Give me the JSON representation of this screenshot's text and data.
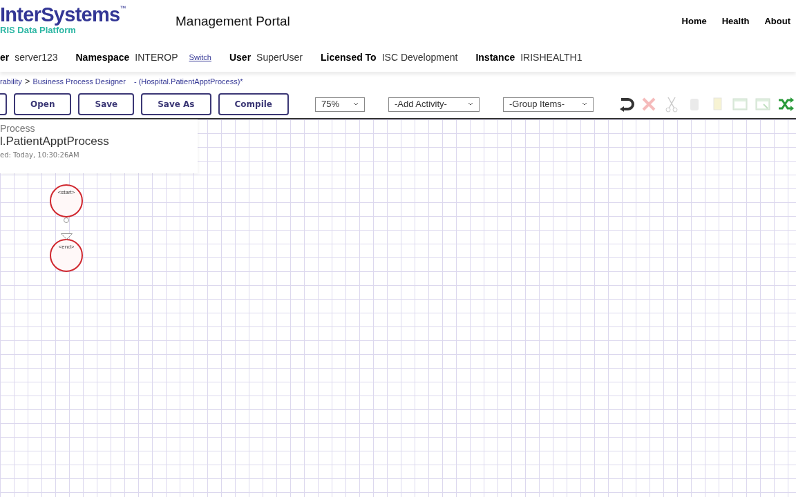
{
  "header": {
    "logo": "InterSystems",
    "logo_tm": "™",
    "logo_subtitle": "RIS Data Platform",
    "title": "Management Portal",
    "nav": [
      "Home",
      "Health",
      "About"
    ]
  },
  "info_bar": [
    {
      "label": "er",
      "value": "server123"
    },
    {
      "label": "Namespace",
      "value": "INTEROP",
      "link": "Switch"
    },
    {
      "label": "User",
      "value": "SuperUser"
    },
    {
      "label": "Licensed To",
      "value": "ISC Development"
    },
    {
      "label": "Instance",
      "value": "IRISHEALTH1"
    }
  ],
  "breadcrumb": {
    "items": [
      "rability",
      "Business Process Designer"
    ],
    "separator": ">",
    "suffix": "- (Hospital.PatientApptProcess)*"
  },
  "toolbar": {
    "buttons": [
      "Open",
      "Save",
      "Save As",
      "Compile"
    ],
    "dropdowns": [
      {
        "value": "75%"
      },
      {
        "value": "-Add Activity-"
      },
      {
        "value": "-Group Items-"
      }
    ],
    "icons": [
      {
        "kind": "undo",
        "disabled": false
      },
      {
        "kind": "delete",
        "disabled": true
      },
      {
        "kind": "cut",
        "disabled": true
      },
      {
        "kind": "copy",
        "disabled": true
      },
      {
        "kind": "paste",
        "disabled": true
      },
      {
        "kind": "group",
        "disabled": true
      },
      {
        "kind": "ungroup",
        "disabled": true
      },
      {
        "kind": "arrange",
        "disabled": false
      }
    ]
  },
  "info_panel": {
    "type": "Process",
    "name": "l.PatientApptProcess",
    "modified": "ed: Today, 10:30:26AM"
  },
  "diagram": {
    "nodes": [
      {
        "label": "<start>"
      },
      {
        "label": "<end>"
      }
    ]
  }
}
